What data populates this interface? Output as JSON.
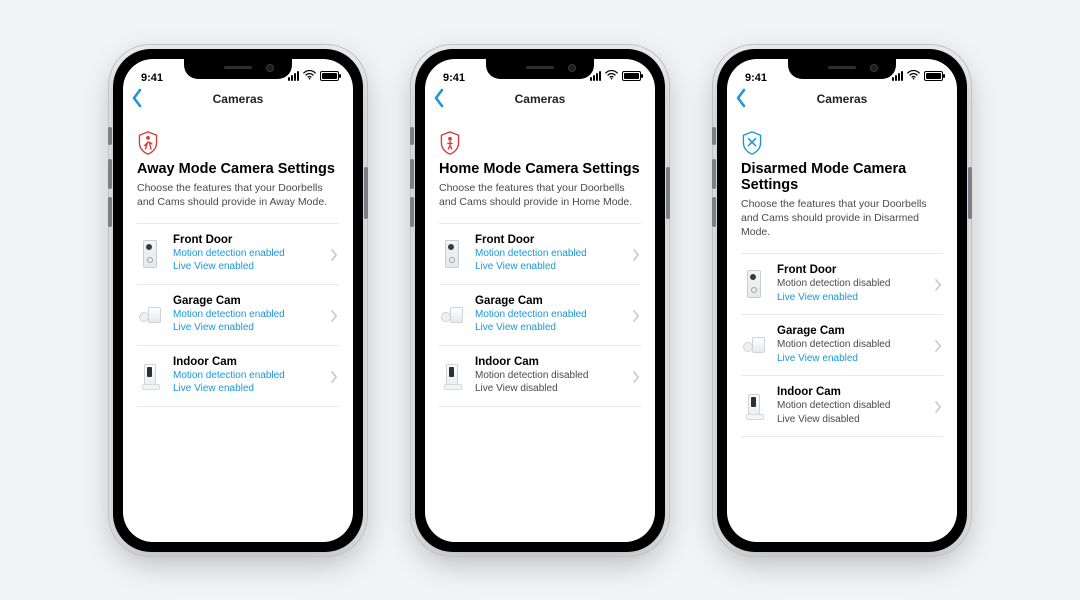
{
  "status": {
    "time": "9:41"
  },
  "nav": {
    "title": "Cameras"
  },
  "colors": {
    "accent": "#1998d5",
    "away": "#d63b3b",
    "home": "#d63b3b",
    "disarmed": "#1998d5"
  },
  "phones": [
    {
      "mode_icon": "away",
      "title": "Away Mode Camera Settings",
      "subtitle": "Choose the features that your Doorbells and Cams should provide in Away Mode.",
      "items": [
        {
          "thumb": "doorbell",
          "name": "Front Door",
          "motion": "Motion detection enabled",
          "motion_on": true,
          "live": "Live View enabled",
          "live_on": true
        },
        {
          "thumb": "spot",
          "name": "Garage Cam",
          "motion": "Motion detection enabled",
          "motion_on": true,
          "live": "Live View enabled",
          "live_on": true
        },
        {
          "thumb": "indoor",
          "name": "Indoor Cam",
          "motion": "Motion detection enabled",
          "motion_on": true,
          "live": "Live View enabled",
          "live_on": true
        }
      ]
    },
    {
      "mode_icon": "home",
      "title": "Home Mode Camera Settings",
      "subtitle": "Choose the features that your Doorbells and Cams should provide in Home Mode.",
      "items": [
        {
          "thumb": "doorbell",
          "name": "Front Door",
          "motion": "Motion detection enabled",
          "motion_on": true,
          "live": "Live View enabled",
          "live_on": true
        },
        {
          "thumb": "spot",
          "name": "Garage Cam",
          "motion": "Motion detection enabled",
          "motion_on": true,
          "live": "Live View enabled",
          "live_on": true
        },
        {
          "thumb": "indoor",
          "name": "Indoor Cam",
          "motion": "Motion detection disabled",
          "motion_on": false,
          "live": "Live View disabled",
          "live_on": false
        }
      ]
    },
    {
      "mode_icon": "disarmed",
      "title": "Disarmed Mode Camera Settings",
      "subtitle": "Choose the features that your Doorbells and Cams should provide in Disarmed Mode.",
      "items": [
        {
          "thumb": "doorbell",
          "name": "Front Door",
          "motion": "Motion detection disabled",
          "motion_on": false,
          "live": "Live View enabled",
          "live_on": true
        },
        {
          "thumb": "spot",
          "name": "Garage Cam",
          "motion": "Motion detection disabled",
          "motion_on": false,
          "live": "Live View enabled",
          "live_on": true
        },
        {
          "thumb": "indoor",
          "name": "Indoor Cam",
          "motion": "Motion detection disabled",
          "motion_on": false,
          "live": "Live View disabled",
          "live_on": false
        }
      ]
    }
  ]
}
